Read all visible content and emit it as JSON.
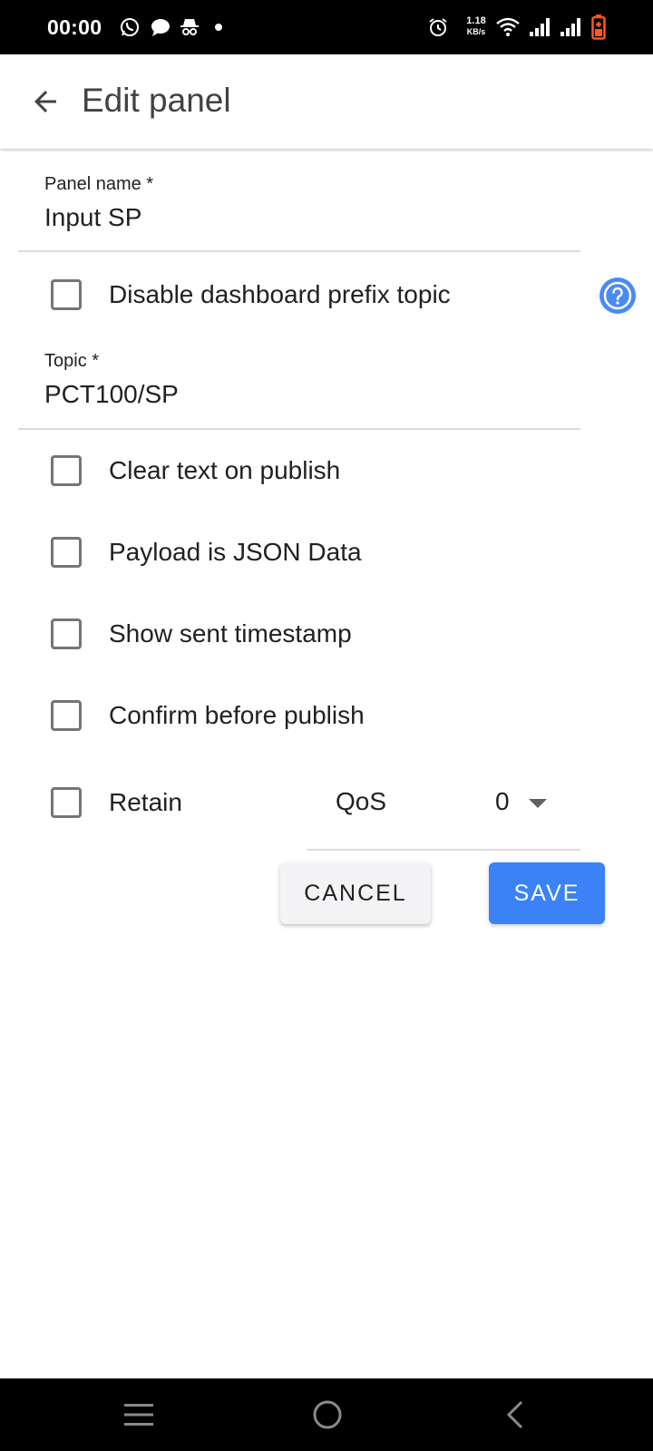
{
  "status_bar": {
    "time": "00:00",
    "net_speed_value": "1.18",
    "net_speed_unit": "KB/s",
    "icons": [
      "whatsapp-icon",
      "chat-bubble-icon",
      "incognito-icon",
      "dot-icon",
      "alarm-icon",
      "wifi-icon",
      "signal-icon",
      "signal-icon",
      "battery-charging-icon"
    ],
    "battery_color": "#ff5722"
  },
  "app_bar": {
    "title": "Edit panel",
    "back_icon": "arrow-back-icon"
  },
  "form": {
    "panel_name": {
      "label": "Panel name *",
      "value": "Input SP"
    },
    "topic": {
      "label": "Topic *",
      "value": "PCT100/SP"
    },
    "options": {
      "disable_prefix": "Disable dashboard prefix topic",
      "clear_text": "Clear text on publish",
      "payload_json": "Payload is JSON Data",
      "show_timestamp": "Show sent timestamp",
      "confirm_publish": "Confirm before publish",
      "retain": "Retain"
    },
    "qos": {
      "label": "QoS",
      "value": "0"
    }
  },
  "actions": {
    "cancel_label": "CANCEL",
    "save_label": "SAVE"
  },
  "colors": {
    "accent": "#3b82f6",
    "help_icon": "#4a8af4"
  },
  "nav_bar": {
    "icons": [
      "menu-icon",
      "home-icon",
      "back-icon"
    ]
  }
}
